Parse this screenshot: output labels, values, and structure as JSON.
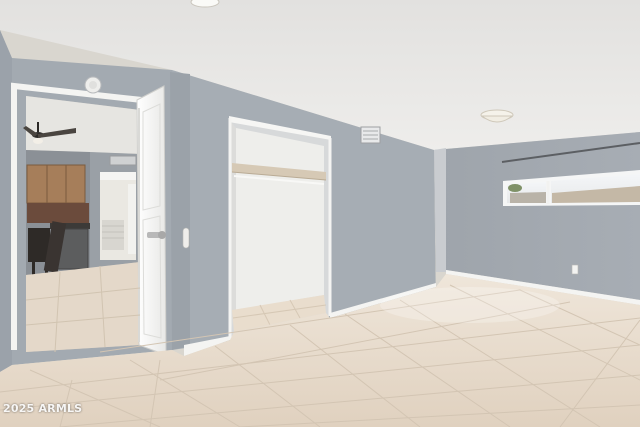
{
  "photo": {
    "watermark": "2025 ARMLS"
  },
  "colors": {
    "ceiling": "#e9e8e6",
    "wall_gray": "#9fa6ae",
    "wall_gray_light": "#a8afb6",
    "trim_white": "#f4f4f2",
    "floor_tile": "#e6dacb",
    "floor_grout": "#d2c4b2",
    "closet_interior": "#efefec",
    "cabinet_wood": "#a67e5a",
    "backsplash": "#6b4b3c",
    "appliance_steel": "#5a5a5a"
  },
  "objects": {
    "entry_door": "open-door",
    "ceiling_light": "ceiling-light-fixture",
    "ceiling_fan": "ceiling-fan",
    "closet": "reach-in-closet",
    "window": "window",
    "vent": "air-vent",
    "outlet": "wall-outlet"
  }
}
